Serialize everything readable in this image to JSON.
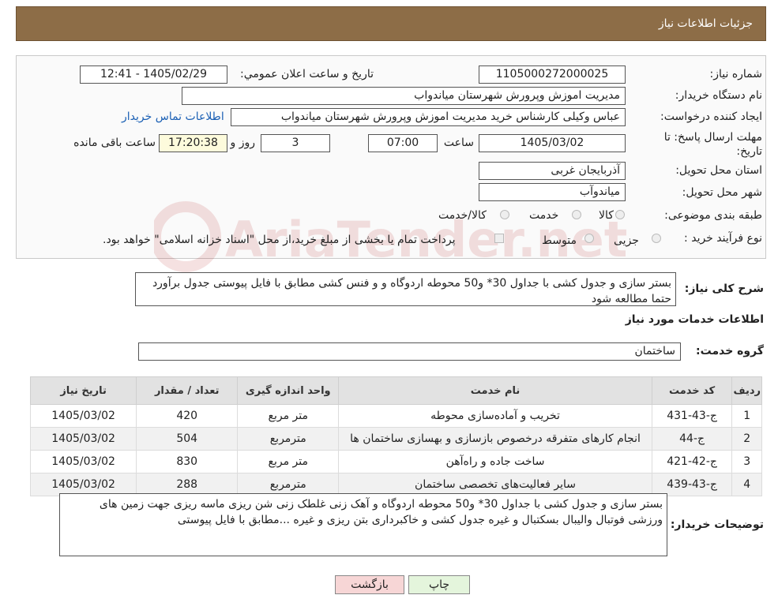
{
  "page": {
    "title": "جزئیات اطلاعات نیاز"
  },
  "labels": {
    "need_number": "شماره نیاز:",
    "announce_datetime": "تاریخ و ساعت اعلان عمومي:",
    "buyer_org": "نام دستگاه خریدار:",
    "requester": "ایجاد کننده درخواست:",
    "reply_deadline": "مهلت ارسال پاسخ: تا تاریخ:",
    "time": "ساعت",
    "day_and": "روز و",
    "remaining": "ساعت باقی مانده",
    "province": "استان محل تحویل:",
    "city": "شهر محل تحویل:",
    "category": "طبقه بندی موضوعی:",
    "process": "نوع فرآیند خرید :",
    "summary": "شرح کلی نیاز:",
    "services_info": "اطلاعات خدمات مورد نیاز",
    "service_group": "گروه خدمت:",
    "buyer_notes": "توضیحات خریدار:"
  },
  "fields": {
    "need_number": "1105000272000025",
    "announce_datetime": "1405/02/29 - 12:41",
    "buyer_org": "مدیریت اموزش وپرورش شهرستان میاندواب",
    "requester": "عباس وکیلی کارشناس خرید مدیریت اموزش وپرورش شهرستان میاندواب",
    "contact_link": "اطلاعات تماس خریدار",
    "deadline_date": "1405/03/02",
    "deadline_time": "07:00",
    "days": "3",
    "remaining_time": "17:20:38",
    "province": "آذربایجان غربی",
    "city": "میاندوآب",
    "service_group": "ساختمان"
  },
  "category_options": [
    {
      "label": "کالا",
      "selected": false
    },
    {
      "label": "خدمت",
      "selected": false
    },
    {
      "label": "کالا/خدمت",
      "selected": false
    }
  ],
  "process_options": [
    {
      "label": "جزیی",
      "selected": false
    },
    {
      "label": "متوسط",
      "selected": false
    }
  ],
  "process_note": "پرداخت تمام یا بخشی از مبلغ خرید،از محل \"اسناد خزانه اسلامی\" خواهد بود.",
  "summary_text": "بستر سازی و جدول کشی با جداول 30* و50 محوطه اردوگاه و و فنس کشی مطابق با فایل پیوستی جدول برآورد حتما مطالعه شود",
  "table": {
    "headers": [
      "ردیف",
      "کد خدمت",
      "نام خدمت",
      "واحد اندازه گیری",
      "تعداد / مقدار",
      "تاریخ نیاز"
    ],
    "rows": [
      [
        "1",
        "ج-43-431",
        "تخریب و آماده‌سازی محوطه",
        "متر مربع",
        "420",
        "1405/03/02"
      ],
      [
        "2",
        "ج-44",
        "انجام کارهای متفرقه درخصوص بازسازی و بهسازی ساختمان ها",
        "مترمربع",
        "504",
        "1405/03/02"
      ],
      [
        "3",
        "ج-42-421",
        "ساخت جاده و راه‌آهن",
        "متر مربع",
        "830",
        "1405/03/02"
      ],
      [
        "4",
        "ج-43-439",
        "سایر فعالیت‌های تخصصی ساختمان",
        "مترمربع",
        "288",
        "1405/03/02"
      ]
    ]
  },
  "buyer_notes_text": "بستر سازی و جدول کشی با جداول 30* و50 محوطه اردوگاه و آهک زنی غلطک زنی شن ریزی ماسه ریزی جهت زمین های ورزشی فوتبال والیبال بسکتبال و غیره  جدول کشی و خاکبرداری بتن ریزی و غیره ...مطابق با فایل پیوستی",
  "buttons": {
    "print": "چاپ",
    "back": "بازگشت"
  },
  "watermark": "AriaTender.net",
  "colors": {
    "header": "#8d6d47",
    "back_button": "#f7d6d6",
    "print_button": "#e4f5dc"
  }
}
